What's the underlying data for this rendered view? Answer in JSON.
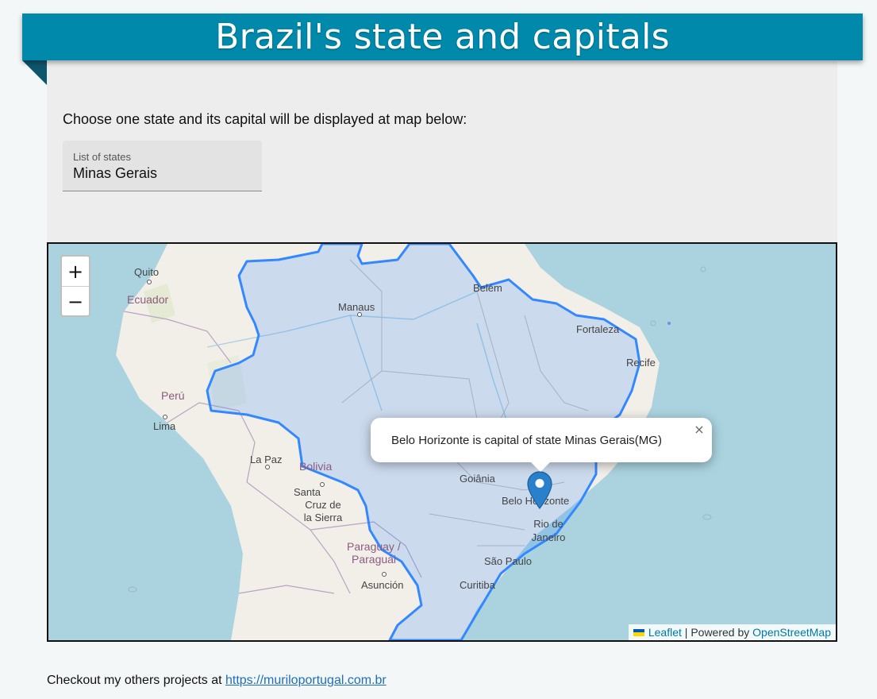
{
  "header": {
    "title": "Brazil's state and capitals"
  },
  "form": {
    "intro": "Choose one state and its capital will be displayed at map below:",
    "select_label": "List of states",
    "select_value": "Minas Gerais"
  },
  "map": {
    "zoom_in": "+",
    "zoom_out": "−",
    "popup_text": "Belo Horizonte is capital of state Minas Gerais(MG)",
    "popup_close": "×",
    "attribution": {
      "leaflet": "Leaflet",
      "separator": " | Powered by ",
      "osm": "OpenStreetMap"
    },
    "cities": {
      "quito": "Quito",
      "lima": "Lima",
      "la_paz": "La Paz",
      "santa_cruz_1": "Santa",
      "santa_cruz_2": "Cruz de",
      "santa_cruz_3": "la Sierra",
      "asuncion": "Asunción",
      "manaus": "Manaus",
      "belem": "Belém",
      "fortaleza": "Fortaleza",
      "recife": "Recife",
      "goiania": "Goiânia",
      "belo_horizonte": "Belo Horizonte",
      "rio_1": "Rio de",
      "rio_2": "Janeiro",
      "sao_paulo": "São Paulo",
      "curitiba": "Curitiba"
    },
    "countries": {
      "ecuador": "Ecuador",
      "peru": "Perú",
      "bolivia": "Bolivia",
      "paraguay_1": "Paraguay /",
      "paraguay_2": "Paraguái"
    },
    "colors": {
      "state_outline": "#3388ff",
      "state_fill": "#3388ff",
      "marker": "#2a81cb"
    }
  },
  "footer": {
    "text": "Checkout my others projects at ",
    "link": "https://muriloportugal.com.br"
  }
}
